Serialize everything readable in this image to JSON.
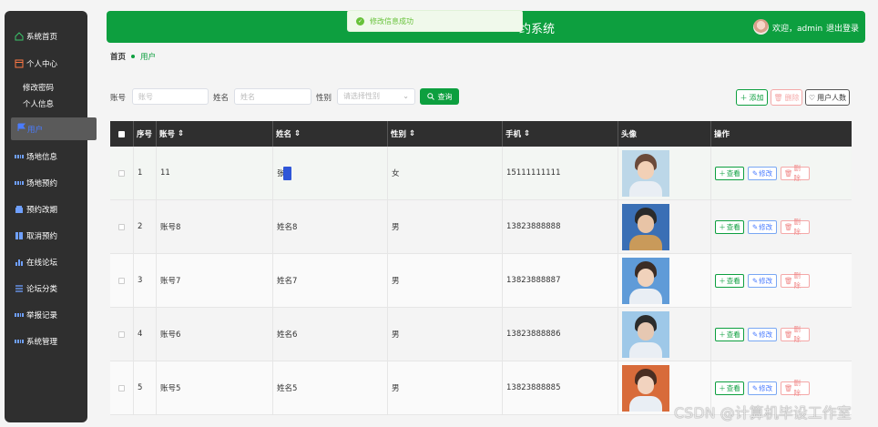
{
  "sidebar": {
    "items": [
      {
        "label": "系统首页",
        "icon": "home-icon"
      },
      {
        "label": "个人中心",
        "icon": "window-icon"
      },
      {
        "label": "修改密码"
      },
      {
        "label": "个人信息"
      },
      {
        "label": "用户",
        "icon": "flag-icon",
        "active": true
      },
      {
        "label": "场地信息",
        "icon": "grid-icon"
      },
      {
        "label": "场地预约",
        "icon": "grid-icon"
      },
      {
        "label": "预约改期",
        "icon": "box-icon"
      },
      {
        "label": "取消预约",
        "icon": "book-icon"
      },
      {
        "label": "在线论坛",
        "icon": "bar-chart-icon"
      },
      {
        "label": "论坛分类",
        "icon": "list-icon"
      },
      {
        "label": "举报记录",
        "icon": "grid-icon"
      },
      {
        "label": "系统管理",
        "icon": "grid-icon"
      }
    ]
  },
  "header": {
    "title": "约系统",
    "welcome": "欢迎，admin",
    "logout": "退出登录"
  },
  "toast": {
    "text": "修改信息成功"
  },
  "breadcrumb": {
    "home": "首页",
    "current": "用户"
  },
  "search": {
    "account_label": "账号",
    "account_placeholder": "账号",
    "name_label": "姓名",
    "name_placeholder": "姓名",
    "gender_label": "性别",
    "gender_placeholder": "请选择性别",
    "button": "查询"
  },
  "actions": {
    "add": "添加",
    "delete": "删除",
    "count": "用户人数"
  },
  "table": {
    "headers": [
      "序号",
      "账号",
      "姓名",
      "性别",
      "手机",
      "头像",
      "操作"
    ],
    "rows": [
      {
        "index": "1",
        "account": "11",
        "name": "张",
        "gender": "女",
        "phone": "15111111111"
      },
      {
        "index": "2",
        "account": "账号8",
        "name": "姓名8",
        "gender": "男",
        "phone": "13823888888"
      },
      {
        "index": "3",
        "account": "账号7",
        "name": "姓名7",
        "gender": "男",
        "phone": "13823888887"
      },
      {
        "index": "4",
        "account": "账号6",
        "name": "姓名6",
        "gender": "男",
        "phone": "13823888886"
      },
      {
        "index": "5",
        "account": "账号5",
        "name": "姓名5",
        "gender": "男",
        "phone": "13823888885"
      }
    ],
    "op_view": "查看",
    "op_edit": "修改",
    "op_delete": "删除"
  },
  "watermark": "CSDN @计算机毕设工作室",
  "colors": {
    "primary": "#0d9f3f",
    "sidebar": "#2f2f2f",
    "danger": "#f08a8a",
    "edit": "#4a7cff"
  }
}
